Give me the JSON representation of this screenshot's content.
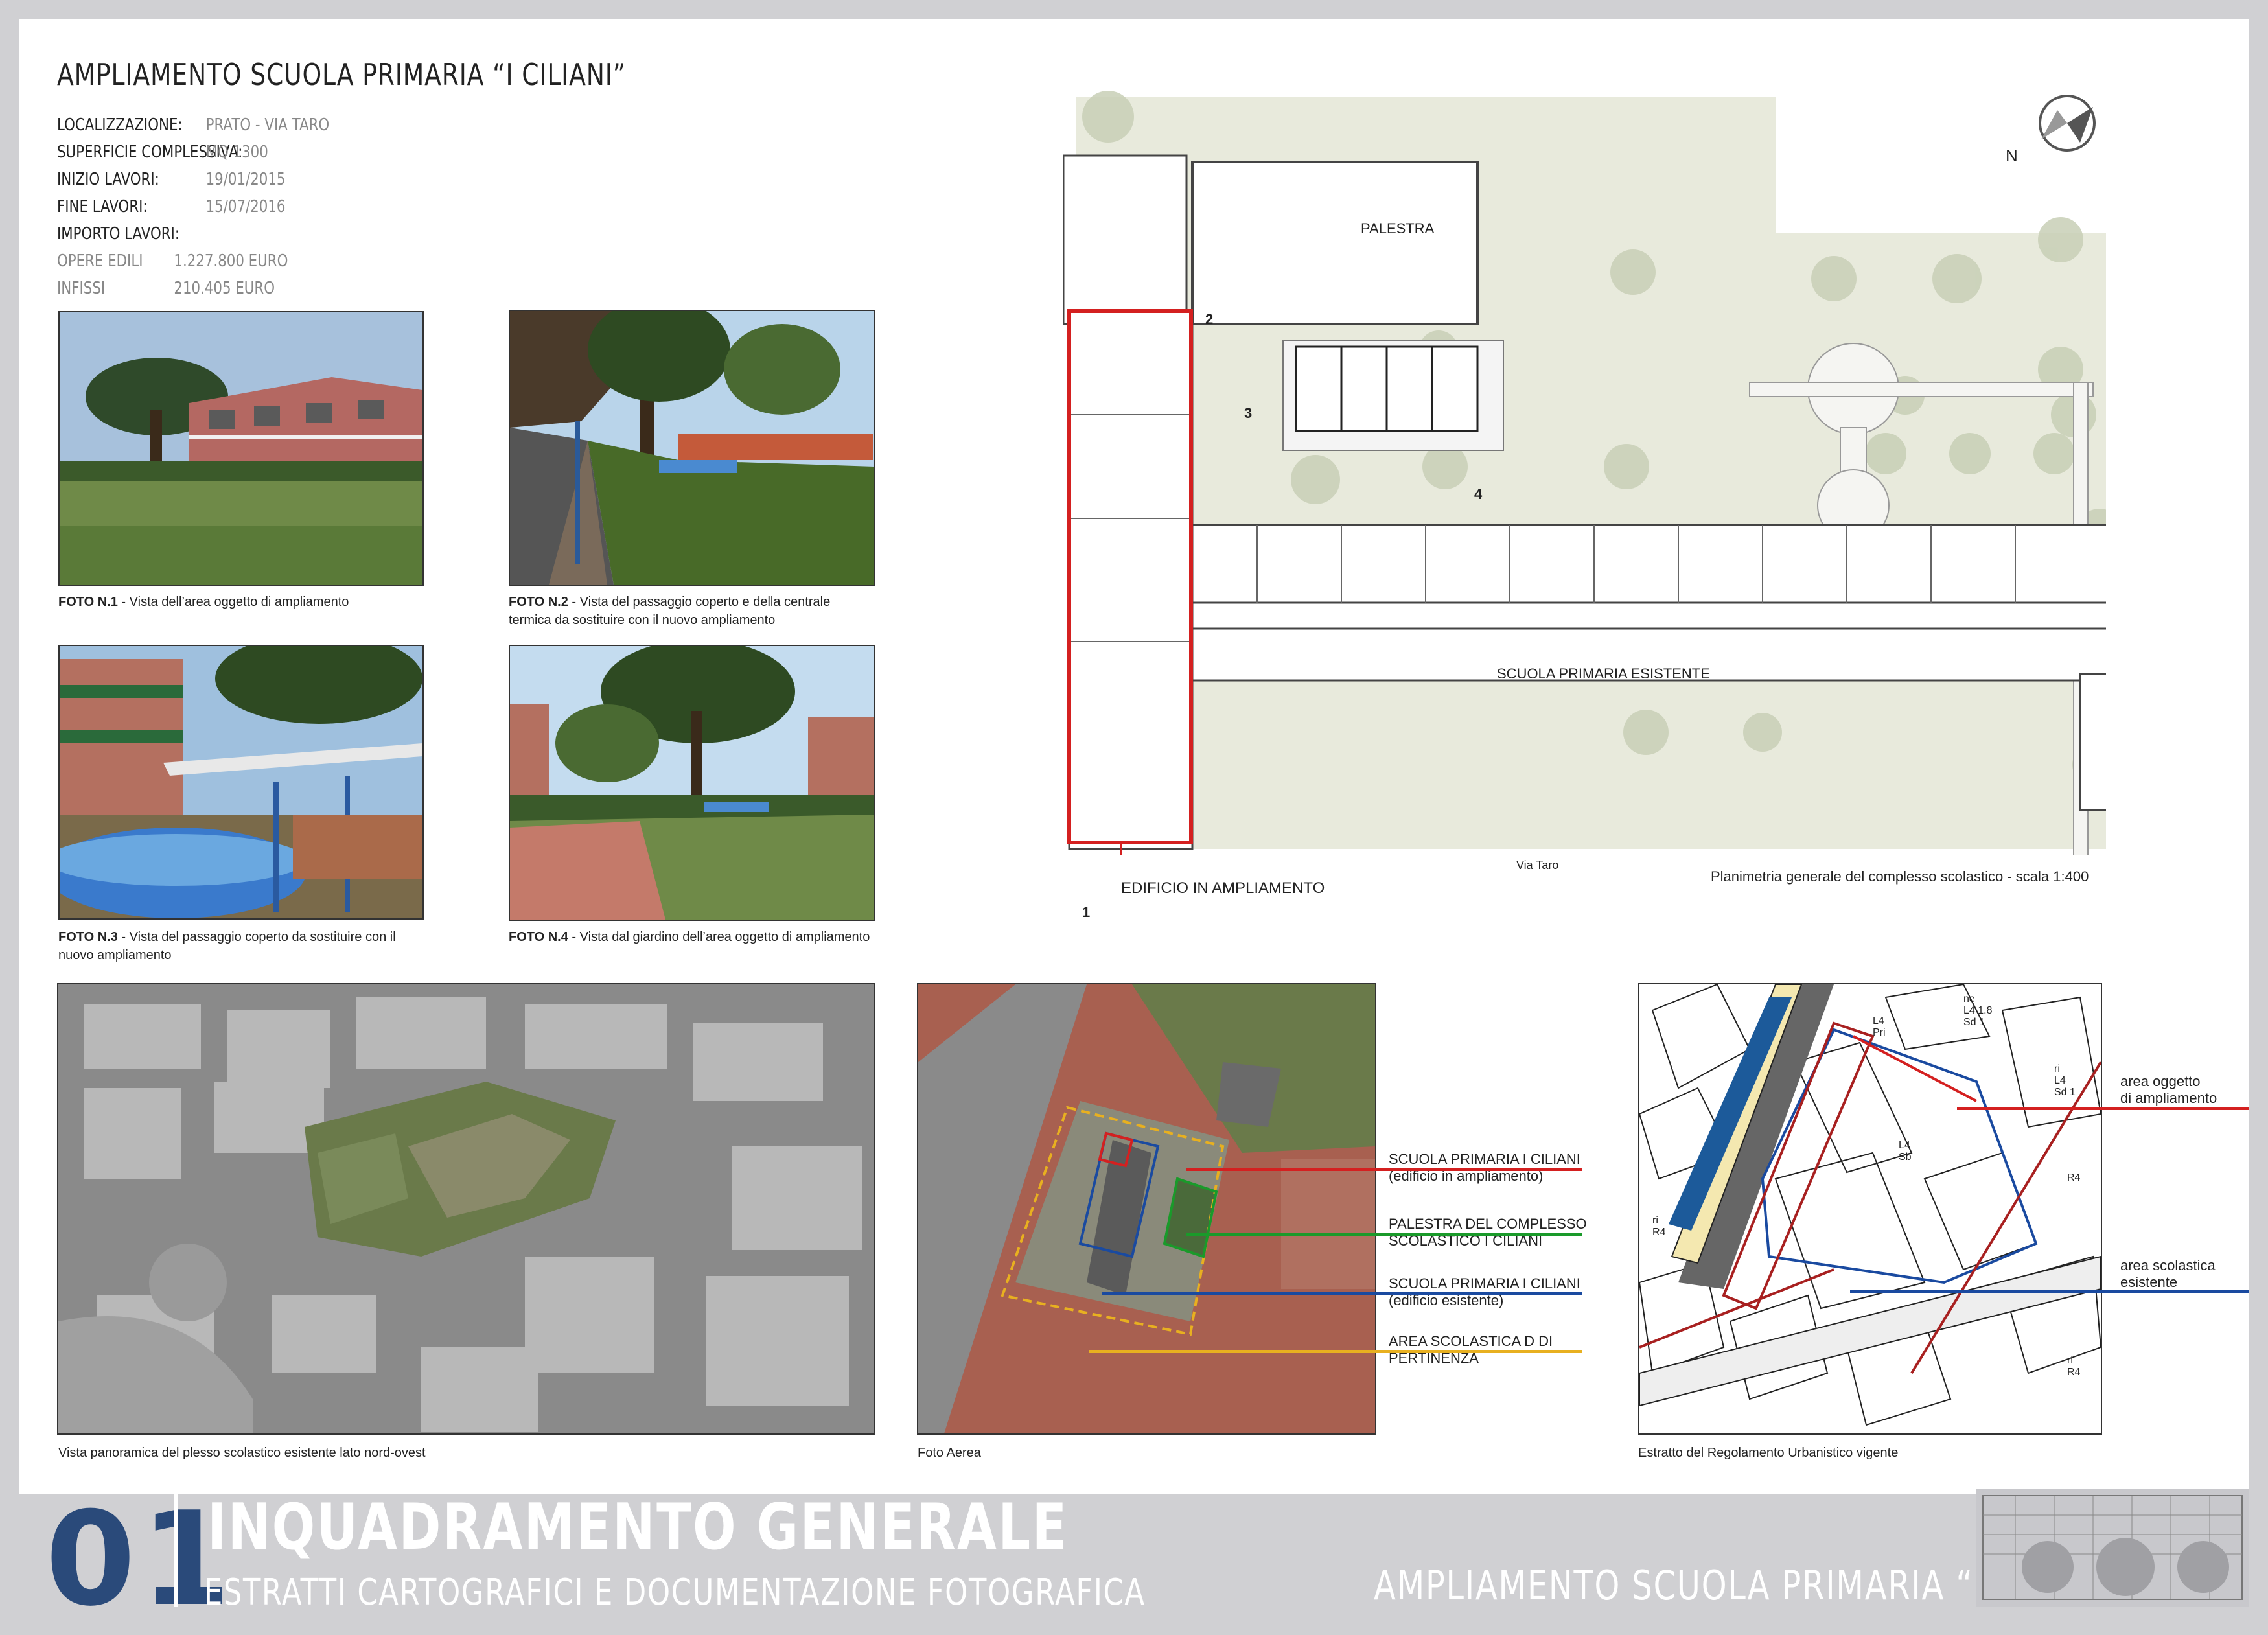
{
  "header": {
    "title": "AMPLIAMENTO SCUOLA PRIMARIA “I CILIANI”"
  },
  "info": {
    "localizzazione_label": "LOCALIZZAZIONE:",
    "localizzazione_value": "PRATO - VIA TARO",
    "superficie_label": "SUPERFICIE COMPLESSIVA:",
    "superficie_value": "MQ 1300",
    "inizio_label": "INIZIO LAVORI:",
    "inizio_value": "19/01/2015",
    "fine_label": "FINE LAVORI:",
    "fine_value": "15/07/2016",
    "importo_label": "IMPORTO LAVORI:",
    "opere_label": "OPERE EDILI",
    "opere_value": "1.227.800 EURO",
    "infissi_label": "INFISSI",
    "infissi_value": "210.405 EURO"
  },
  "photos": [
    {
      "num": "FOTO N.1",
      "text": " - Vista dell’area oggetto di ampliamento"
    },
    {
      "num": "FOTO N.2",
      "text": " - Vista del passaggio coperto e della centrale termica da sostituire con il nuovo ampliamento"
    },
    {
      "num": "FOTO N.3",
      "text": " - Vista del passaggio coperto da sostituire con il nuovo ampliamento"
    },
    {
      "num": "FOTO N.4",
      "text": " - Vista dal giardino dell’area oggetto di ampliamento"
    }
  ],
  "plan": {
    "palestra": "PALESTRA",
    "scuola": "SCUOLA PRIMARIA ESISTENTE",
    "edificio": "EDIFICIO IN AMPLIAMENTO",
    "via": "Via Taro",
    "caption": "Planimetria generale del complesso scolastico - scala 1:400",
    "north": "N",
    "v1": "1",
    "v2": "2",
    "v3": "3",
    "v4": "4"
  },
  "bottom_images": {
    "panoramic_caption": "Vista panoramica del plesso scolastico esistente lato nord-ovest",
    "aerial_caption": "Foto Aerea",
    "ru_caption": "Estratto del Regolamento Urbanistico vigente"
  },
  "aerial_legend": [
    {
      "l1": "SCUOLA PRIMARIA I CILIANI",
      "l2": "(edificio in ampliamento)",
      "color": "#d42020"
    },
    {
      "l1": "PALESTRA DEL COMPLESSO",
      "l2": "SCOLASTICO I CILIANI",
      "color": "#1a9a2a"
    },
    {
      "l1": "SCUOLA PRIMARIA I CILIANI",
      "l2": "(edificio esistente)",
      "color": "#1a4aa0"
    },
    {
      "l1": "AREA SCOLASTICA D DI",
      "l2": "PERTINENZA",
      "color": "#e8b020"
    }
  ],
  "ru_legend": [
    {
      "l1": "area oggetto",
      "l2": "di ampliamento",
      "color": "#d42020"
    },
    {
      "l1": "area scolastica",
      "l2": "esistente",
      "color": "#1a4aa0"
    }
  ],
  "ru_labels": {
    "ne": "ne",
    "l418": "L4 1.8",
    "sd1": "Sd 1",
    "l4": "L4",
    "pri": "Pri",
    "ri": "ri",
    "l4b": "L4",
    "sd1b": "Sd 1",
    "l4c": "L4",
    "sb": "Sb",
    "r4": "R4",
    "r4b": "R4",
    "r4c": "R4",
    "ri2": "ri",
    "ri3": "ri"
  },
  "footer": {
    "number": "01",
    "title": "INQUADRAMENTO GENERALE",
    "subtitle": "ESTRATTI CARTOGRAFICI E DOCUMENTAZIONE FOTOGRAFICA",
    "right": "AMPLIAMENTO SCUOLA PRIMARIA “I CILIANI”"
  }
}
